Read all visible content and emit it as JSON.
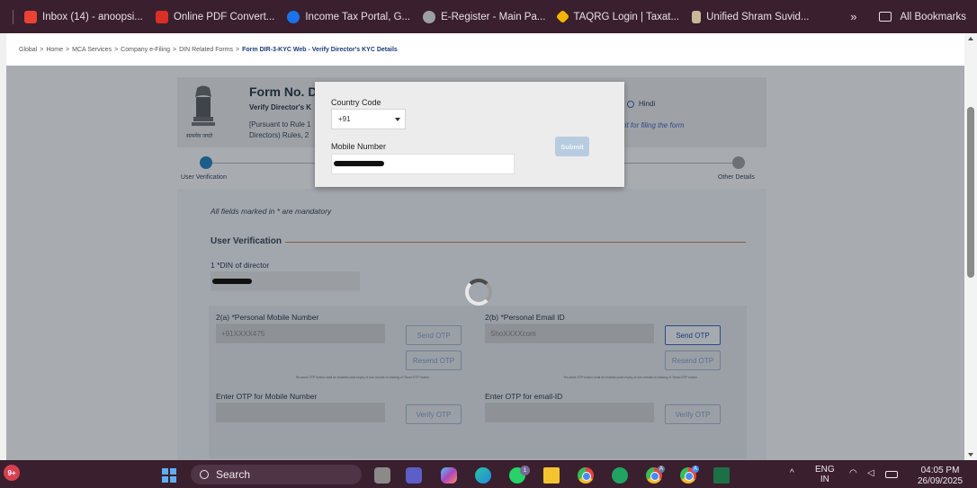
{
  "bookmarks": {
    "items": [
      {
        "label": "Inbox (14) - anoopsi...",
        "icon": "gmail-icon",
        "color": "#ea4335"
      },
      {
        "label": "Online PDF Convert...",
        "icon": "pdf-icon",
        "color": "#d93025"
      },
      {
        "label": "Income Tax Portal, G...",
        "icon": "income-tax-icon",
        "color": "#1a73e8"
      },
      {
        "label": "E-Register - Main Pa...",
        "icon": "globe-icon",
        "color": "#9aa0a6"
      },
      {
        "label": "TAQRG Login | Taxat...",
        "icon": "taqrg-icon",
        "color": "#f4b400"
      },
      {
        "label": "Unified Shram Suvid...",
        "icon": "emblem-icon",
        "color": "#c8b898"
      }
    ],
    "overflow": "»",
    "all_bookmarks": "All Bookmarks"
  },
  "breadcrumb": {
    "items": [
      "Global",
      "Home",
      "MCA Services",
      "Company e-Filing",
      "DIN Related Forms"
    ],
    "current": "Form DIR-3-KYC Web - Verify Director's KYC Details",
    "separator": ">"
  },
  "form": {
    "title": "Form No. D",
    "subtitle": "Verify Director's K",
    "pursuant": "[Pursuant to Rule 1 Directors) Rules, 2",
    "language_hindi": "Hindi",
    "kit_link": "n kit for filing the form",
    "emblem_caption": "सत्यमेव जयते",
    "steps": [
      {
        "label": "User Verification",
        "active": true
      },
      {
        "label": "Other Details",
        "active": false
      }
    ],
    "mandatory_note": "All fields marked in * are mandatory",
    "section_title": "User Verification",
    "din_label": "1 *DIN of director",
    "mobile_label": "2(a) *Personal Mobile Number",
    "mobile_value": "+91XXXX475",
    "email_label": "2(b) *Personal Email ID",
    "email_value": "ShoXXXXcom",
    "send_otp": "Send OTP",
    "resend_otp": "Resend OTP",
    "verify_otp": "Verify OTP",
    "otp_note": "Re-send OTP button shall be enabled post expiry of one minute of clicking of 'Send OTP' button",
    "otp_mobile_label": "Enter OTP for Mobile Number",
    "otp_email_label": "Enter OTP for email-ID"
  },
  "modal": {
    "country_code_label": "Country Code",
    "country_code_value": "+91",
    "mobile_label": "Mobile Number",
    "submit": "Submit"
  },
  "taskbar": {
    "notification_badge": "9+",
    "search": "Search",
    "whatsapp_badge": "1",
    "profile_badge": "A",
    "lang_line1": "ENG",
    "lang_line2": "IN",
    "time": "04:05 PM",
    "date": "26/09/2025"
  }
}
